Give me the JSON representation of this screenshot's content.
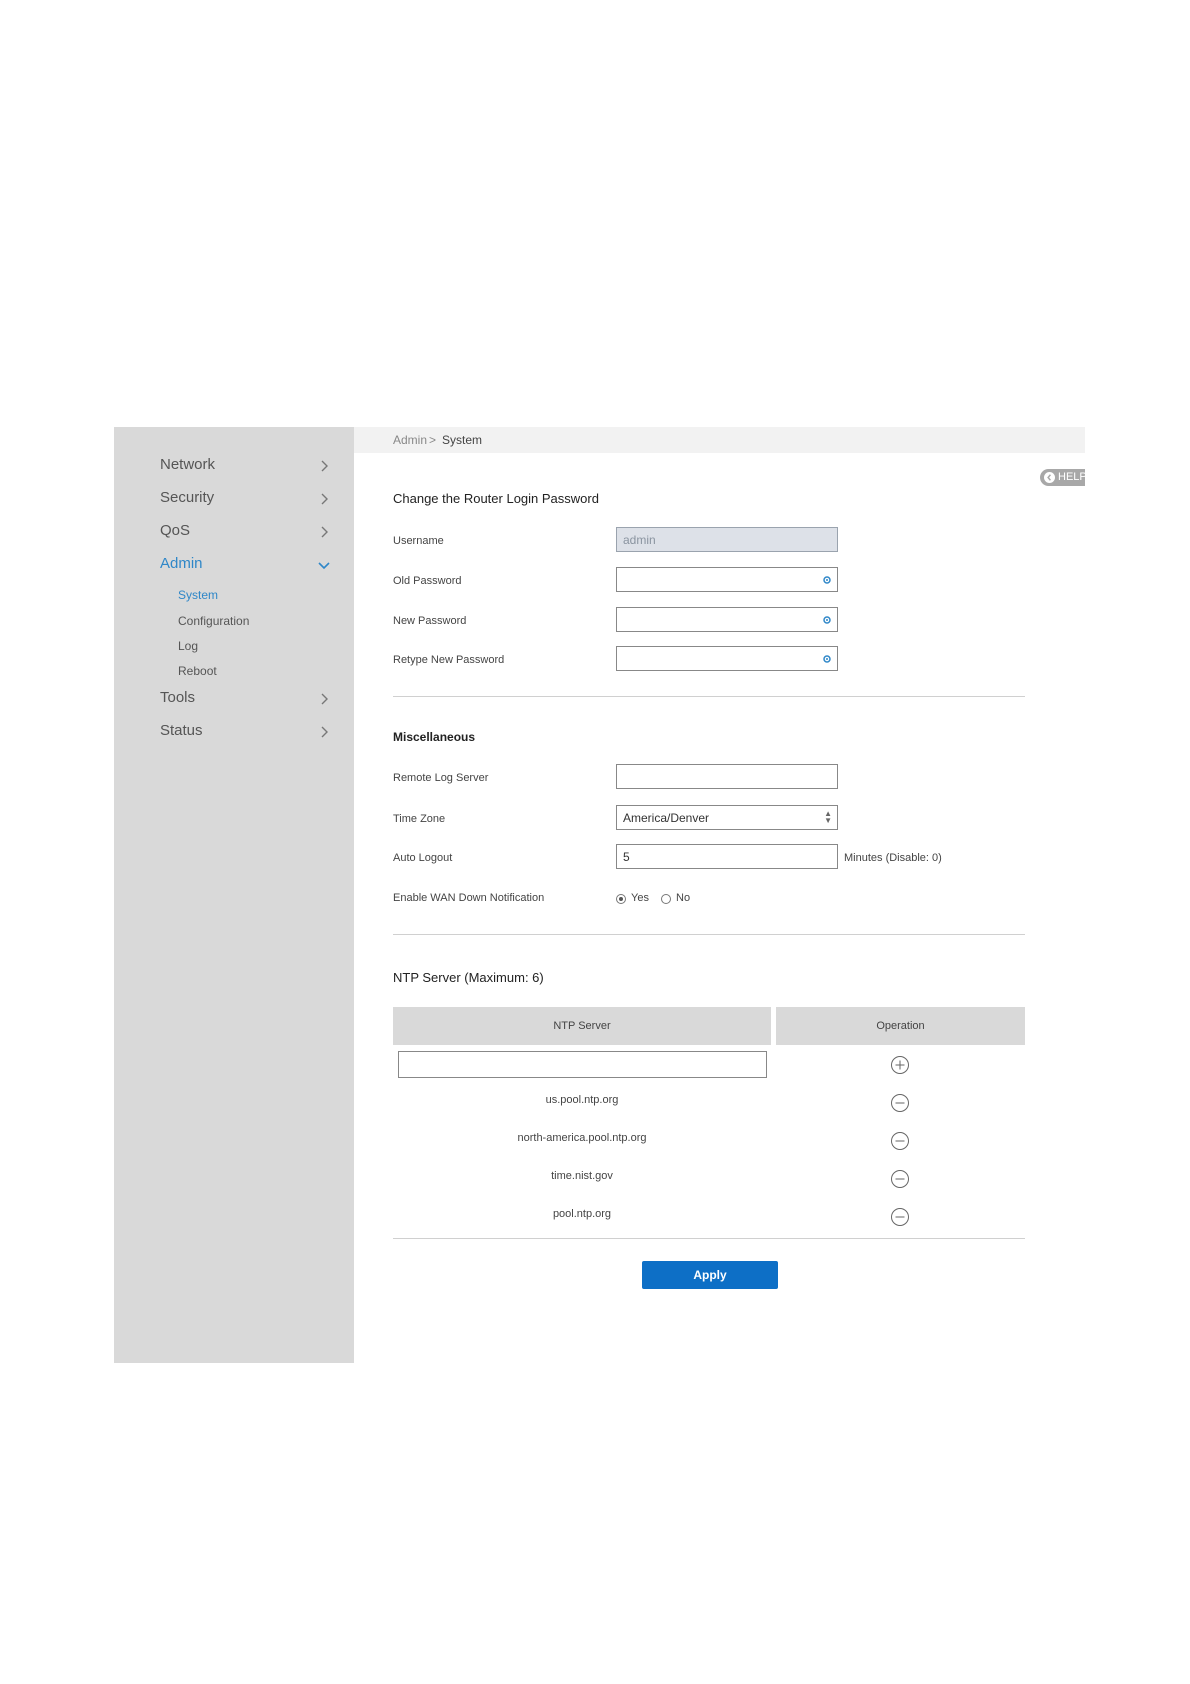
{
  "sidebar": {
    "items": [
      {
        "label": "Network"
      },
      {
        "label": "Security"
      },
      {
        "label": "QoS"
      },
      {
        "label": "Admin"
      },
      {
        "label": "Tools"
      },
      {
        "label": "Status"
      }
    ],
    "admin_sub": [
      {
        "label": "System"
      },
      {
        "label": "Configuration"
      },
      {
        "label": "Log"
      },
      {
        "label": "Reboot"
      }
    ]
  },
  "breadcrumb": {
    "parent": "Admin",
    "separator": ">",
    "current": "System"
  },
  "help_label": "HELP",
  "password_section": {
    "title": "Change the Router Login Password",
    "username_label": "Username",
    "username_value": "admin",
    "old_password_label": "Old Password",
    "new_password_label": "New Password",
    "retype_password_label": "Retype New Password"
  },
  "misc_section": {
    "title": "Miscellaneous",
    "remote_log_label": "Remote Log Server",
    "remote_log_value": "",
    "timezone_label": "Time Zone",
    "timezone_value": "America/Denver",
    "auto_logout_label": "Auto Logout",
    "auto_logout_value": "5",
    "auto_logout_hint": "Minutes (Disable: 0)",
    "wan_notify_label": "Enable WAN Down Notification",
    "wan_notify_yes": "Yes",
    "wan_notify_no": "No",
    "wan_notify_selected": "Yes"
  },
  "ntp_section": {
    "title": "NTP Server (Maximum: 6)",
    "col_server": "NTP Server",
    "col_operation": "Operation",
    "new_server_value": "",
    "servers": [
      "us.pool.ntp.org",
      "north-america.pool.ntp.org",
      "time.nist.gov",
      "pool.ntp.org"
    ]
  },
  "apply_label": "Apply",
  "colors": {
    "accent": "#2f87c8",
    "apply_button": "#0d6fc6",
    "sidebar_bg": "#d9d9d9"
  }
}
